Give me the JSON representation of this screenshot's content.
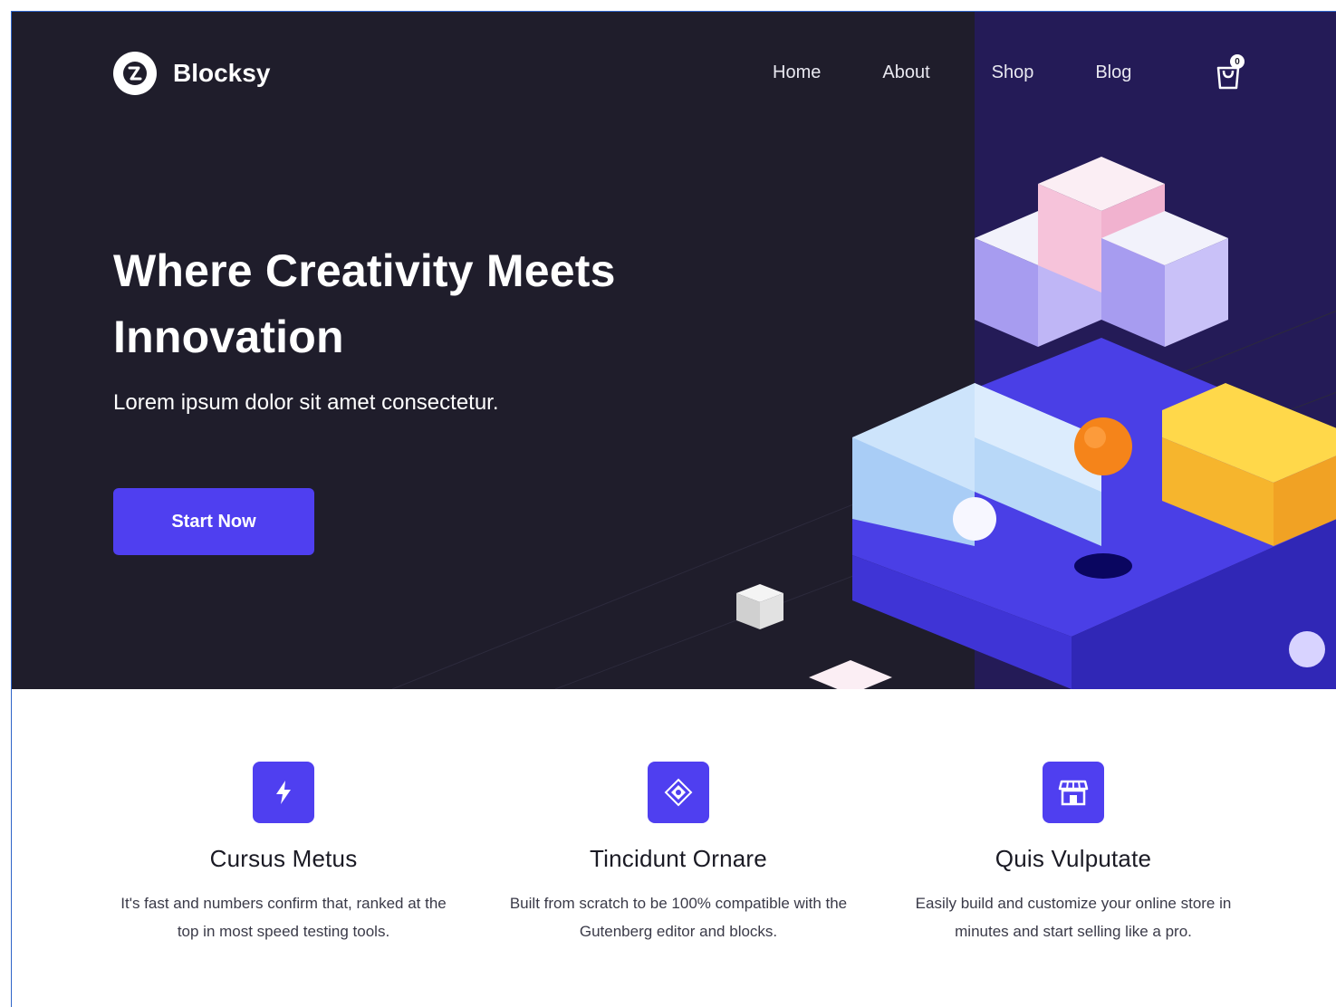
{
  "header": {
    "brand_name": "Blocksy",
    "nav": [
      "Home",
      "About",
      "Shop",
      "Blog"
    ],
    "cart_count": "0"
  },
  "hero": {
    "headline": "Where Creativity Meets Innovation",
    "subline": "Lorem ipsum dolor sit amet consectetur.",
    "cta_label": "Start Now"
  },
  "features": [
    {
      "icon": "lightning-icon",
      "title": "Cursus Metus",
      "text": "It's fast and numbers confirm that, ranked at the top in most speed testing tools."
    },
    {
      "icon": "gutenberg-block-icon",
      "title": "Tincidunt Ornare",
      "text": "Built from scratch to be 100% compatible with the Gutenberg editor and blocks."
    },
    {
      "icon": "storefront-icon",
      "title": "Quis Vulputate",
      "text": "Easily build and customize your online store in minutes and start selling like a pro."
    }
  ],
  "colors": {
    "hero_bg": "#1f1d2b",
    "hero_right_bg": "#241b57",
    "accent": "#4f3ff0"
  }
}
